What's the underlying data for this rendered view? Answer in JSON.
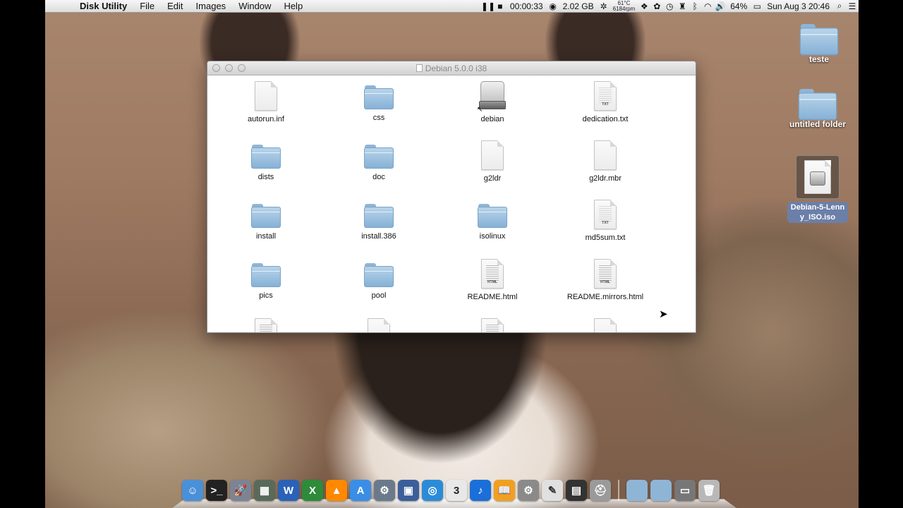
{
  "menubar": {
    "apple_icon": "apple-icon",
    "app_name": "Disk Utility",
    "menus": [
      "File",
      "Edit",
      "Images",
      "Window",
      "Help"
    ],
    "timer": "00:00:33",
    "memory": "2.02 GB",
    "temperature": "61°C",
    "fan_speed": "6184rpm",
    "battery": "64%",
    "clock": "Sun Aug 3  20:46"
  },
  "finder": {
    "title": "Debian 5.0.0 i38",
    "items": [
      {
        "name": "autorun.inf",
        "kind": "doc"
      },
      {
        "name": "css",
        "kind": "folder"
      },
      {
        "name": "debian",
        "kind": "disk"
      },
      {
        "name": "dedication.txt",
        "kind": "txt"
      },
      {
        "name": "dists",
        "kind": "folder"
      },
      {
        "name": "doc",
        "kind": "folder"
      },
      {
        "name": "g2ldr",
        "kind": "doc"
      },
      {
        "name": "g2ldr.mbr",
        "kind": "doc"
      },
      {
        "name": "install",
        "kind": "folder"
      },
      {
        "name": "install.386",
        "kind": "folder"
      },
      {
        "name": "isolinux",
        "kind": "folder"
      },
      {
        "name": "md5sum.txt",
        "kind": "txt"
      },
      {
        "name": "pics",
        "kind": "folder"
      },
      {
        "name": "pool",
        "kind": "folder"
      },
      {
        "name": "README.html",
        "kind": "html"
      },
      {
        "name": "README.mirrors.html",
        "kind": "html"
      }
    ],
    "tags": {
      "txt": "TXT",
      "html": "HTML"
    }
  },
  "desktop": {
    "items": [
      "teste",
      "untitled folder",
      "Debian-5-Lenny_ISO.iso"
    ]
  },
  "dock": {
    "apps": [
      {
        "name": "finder",
        "color": "#4a90d9",
        "glyph": "☺"
      },
      {
        "name": "terminal",
        "color": "#222222",
        "glyph": ">_"
      },
      {
        "name": "launchpad",
        "color": "#7c8494",
        "glyph": "🚀"
      },
      {
        "name": "activity-monitor",
        "color": "#5a6a5a",
        "glyph": "▦"
      },
      {
        "name": "word",
        "color": "#2a62b8",
        "glyph": "W"
      },
      {
        "name": "excel",
        "color": "#2e8b3a",
        "glyph": "X"
      },
      {
        "name": "vlc",
        "color": "#ff8800",
        "glyph": "▲"
      },
      {
        "name": "app-store",
        "color": "#3a8ee6",
        "glyph": "A"
      },
      {
        "name": "network-utility",
        "color": "#6a7a8a",
        "glyph": "⚙"
      },
      {
        "name": "preview",
        "color": "#3a5f9a",
        "glyph": "▣"
      },
      {
        "name": "safari",
        "color": "#2a8cd8",
        "glyph": "◎"
      },
      {
        "name": "calendar",
        "color": "#e8e8e8",
        "glyph": "3"
      },
      {
        "name": "itunes",
        "color": "#1a6fd8",
        "glyph": "♪"
      },
      {
        "name": "ibooks",
        "color": "#f0a020",
        "glyph": "📖"
      },
      {
        "name": "system-preferences",
        "color": "#8a8a8a",
        "glyph": "⚙"
      },
      {
        "name": "textedit",
        "color": "#e0e0e0",
        "glyph": "✎"
      },
      {
        "name": "photo-booth",
        "color": "#333333",
        "glyph": "▤"
      },
      {
        "name": "disk-utility",
        "color": "#9a9a9a",
        "glyph": "⛑"
      }
    ],
    "stack_items": [
      {
        "name": "applications-stack",
        "color": "#8fb5d6",
        "glyph": ""
      },
      {
        "name": "documents-stack",
        "color": "#8fb5d6",
        "glyph": ""
      },
      {
        "name": "downloads-stack",
        "color": "#777777",
        "glyph": "▭"
      },
      {
        "name": "trash",
        "color": "#b8b8b8",
        "glyph": "🗑"
      }
    ]
  }
}
